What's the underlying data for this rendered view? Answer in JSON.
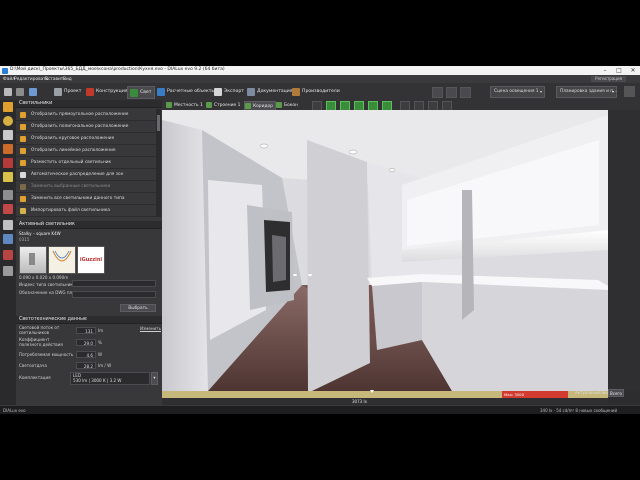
{
  "titlebar": {
    "title": "D:\\Мой диск\\_Проекты\\365_БДД_мое\\ксона\\production\\Кухня.evo - DIALux evo 9.2 (64 бита)",
    "min": "–",
    "max": "□",
    "close": "✕"
  },
  "menu": {
    "file": "Файл",
    "edit": "Редактировать",
    "insert": "Вставить",
    "view": "Вид",
    "help": "Регистрация"
  },
  "toolbar": {
    "project": "Проект",
    "construction": "Конструкция",
    "light": "Свет",
    "calc_objects": "Расчетные объекты",
    "export": "Экспорт",
    "documentation": "Документация",
    "manufacturers": "Производители",
    "scene_select": "Сцена освещения 1",
    "plan_select": "Планировка здания и п..."
  },
  "view_tabs": {
    "tab1": "Местность 1",
    "tab2": "Строение 1",
    "tab3": "Коридор",
    "tab4": "Бокон"
  },
  "panel": {
    "header": "Светильники",
    "items": [
      "Отобразить прямоугольное расположение",
      "Отобразить полигональное расположение",
      "Отобразить круговое расположение",
      "Отобразить линейное расположение",
      "Разместить отдельный светильник",
      "Автоматическое распределение для зон",
      "Заменить выбранные светильники",
      "Заменить все светильники данного типа",
      "Импортировать файл светильника"
    ],
    "active_header": "Активный светильник",
    "luminaire_name": "Stalky – square K4W",
    "luminaire_code": "0315",
    "luminaire_dims": "0.090 x 0.020 x 0.090m",
    "brand": "iGuzzini",
    "index_label": "Индекс типа светильника",
    "designation_label": "Обозначение на DWG плане",
    "choose_btn": "Выбрать",
    "tech_header": "Светотехнические данные",
    "flux_label": "Световой поток от светильников",
    "flux_value": "131",
    "flux_unit": "lm",
    "modify_link": "Изменить",
    "efficiency_label": "Коэффициент полезного действия",
    "efficiency_value": "29.0",
    "efficiency_unit": "%",
    "power_label": "Потребляемая мощность",
    "power_value": "4.6",
    "power_unit": "W",
    "efficacy_label": "Светоотдача",
    "efficacy_value": "28.2",
    "efficacy_unit": "lm / W",
    "lamp_label": "Комплектация",
    "lamp_type": "LED",
    "lamp_values": "530 lm  |  3000 K  |  3.2 W"
  },
  "luxbar": {
    "max_label": "Max: 3000",
    "scale_label": "3073 lx",
    "viewmode": "Актуальный вид",
    "view_button": "Всего"
  },
  "status": {
    "left": "DIALux evo",
    "right": "340 lx  ·  54 cd/m²   8 новых сообщений"
  },
  "colors": {
    "accent_green": "#3a8c3a",
    "light_orange": "#e0a030",
    "bar_red": "#d23b30",
    "bar_gold": "#c6b87a"
  }
}
